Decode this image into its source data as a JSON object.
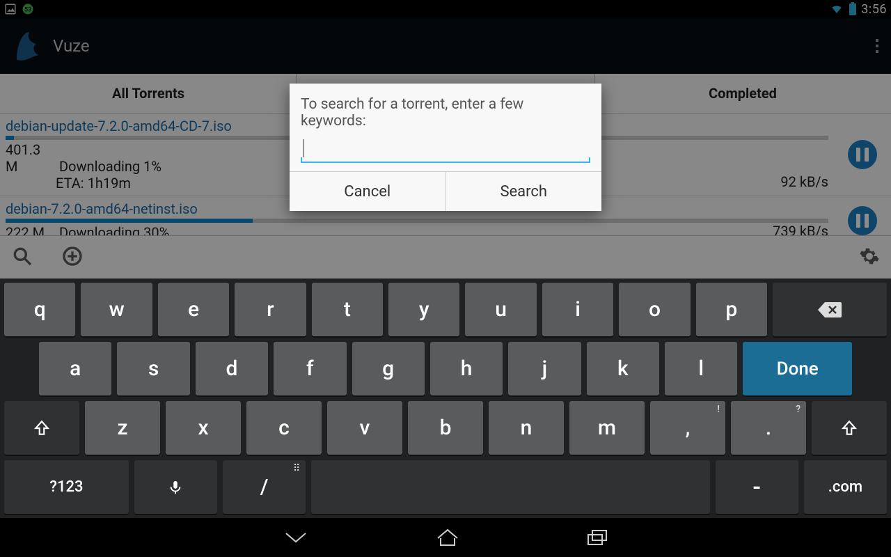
{
  "status_bar": {
    "clock": "3:56"
  },
  "app": {
    "title": "Vuze"
  },
  "tabs": [
    "All Torrents",
    "",
    "Completed"
  ],
  "torrents": [
    {
      "name": "debian-update-7.2.0-amd64-CD-7.iso",
      "size": "401.3 M",
      "status": "Downloading 1%",
      "eta": "ETA: 1h19m",
      "speed": "92 kB/s",
      "progress_pct": 1
    },
    {
      "name": "debian-7.2.0-amd64-netinst.iso",
      "size": "222 M",
      "status": "Downloading 30%",
      "eta": "",
      "speed": "739 kB/s",
      "progress_pct": 30
    }
  ],
  "dialog": {
    "prompt": "To search for a torrent, enter a few keywords:",
    "input_value": "",
    "cancel": "Cancel",
    "search": "Search"
  },
  "keyboard": {
    "row1": [
      "q",
      "w",
      "e",
      "r",
      "t",
      "y",
      "u",
      "i",
      "o",
      "p"
    ],
    "row2": [
      "a",
      "s",
      "d",
      "f",
      "g",
      "h",
      "j",
      "k",
      "l"
    ],
    "row3": [
      "z",
      "x",
      "c",
      "v",
      "b",
      "n",
      "m",
      ",",
      "."
    ],
    "symbols_key": "?123",
    "slash_key": "/",
    "dash_key": "-",
    "dotcom_key": ".com",
    "done_key": "Done",
    "sup_comma": "!",
    "sup_period": "?"
  }
}
